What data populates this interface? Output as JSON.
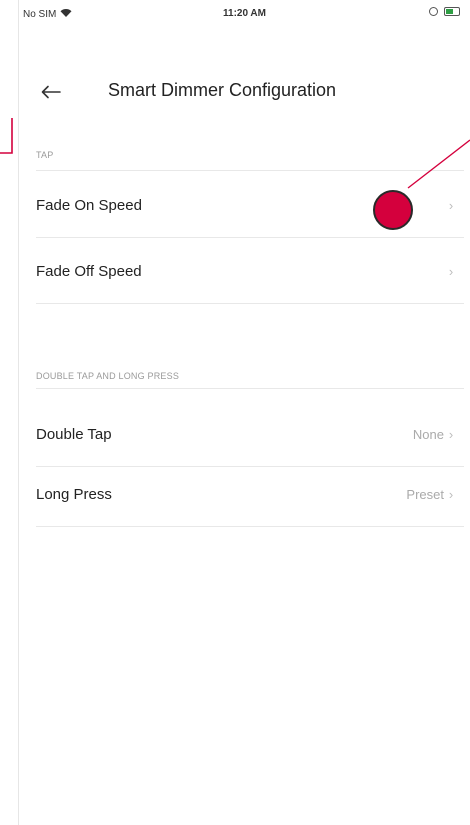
{
  "status_bar": {
    "carrier": "No SIM",
    "time": "11:20 AM"
  },
  "nav": {
    "title": "Smart Dimmer Configuration"
  },
  "sections": [
    {
      "header": "TAP",
      "rows": [
        {
          "label": "Fade On Speed",
          "value": ""
        },
        {
          "label": "Fade Off Speed",
          "value": ""
        }
      ]
    },
    {
      "header": "DOUBLE TAP AND LONG PRESS",
      "rows": [
        {
          "label": "Double Tap",
          "value": "None"
        },
        {
          "label": "Long Press",
          "value": "Preset"
        }
      ]
    }
  ],
  "icons": {
    "back": "arrow-left-icon",
    "chevron": "chevron-right-icon",
    "wifi": "wifi-icon",
    "battery": "battery-icon"
  },
  "colors": {
    "annotation": "#d4003d",
    "battery": "#2e9e44",
    "secondary_text": "#9a9a9a"
  }
}
